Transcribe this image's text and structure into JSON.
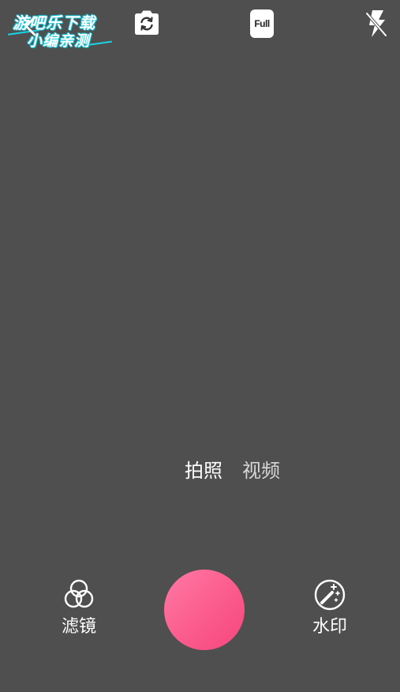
{
  "watermark": {
    "line1": "游吧乐下载",
    "line2": "小编亲测"
  },
  "top_bar": {
    "back_icon": "chevron-left-icon",
    "switch_camera_icon": "switch-camera-icon",
    "full_label": "Full",
    "flash_icon": "flash-off-icon"
  },
  "modes": {
    "photo": "拍照",
    "video": "视频",
    "active": "photo"
  },
  "bottom": {
    "filter_label": "滤镜",
    "filter_icon": "filter-circles-icon",
    "watermark_label": "水印",
    "watermark_icon": "magic-wand-icon"
  },
  "colors": {
    "background": "#4f4f4f",
    "shutter": "#fb5b8d",
    "watermark_accent": "#19d4e6"
  }
}
